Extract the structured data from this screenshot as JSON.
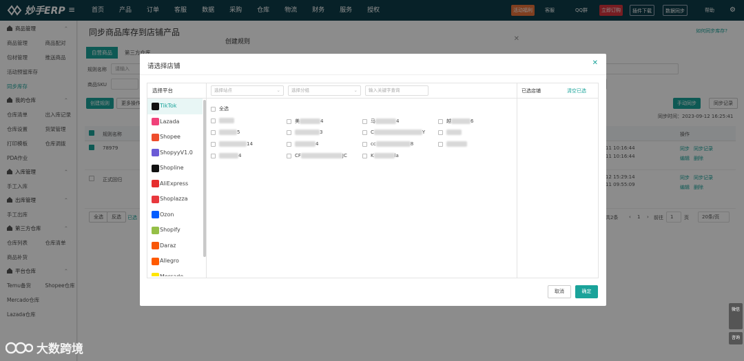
{
  "app": {
    "logo_text": "妙手ERP"
  },
  "nav": {
    "items": [
      "首页",
      "产品",
      "订单",
      "客服",
      "数据",
      "采购",
      "仓库",
      "物流",
      "财务",
      "服务",
      "授权"
    ]
  },
  "topbar": {
    "tools": [
      "活动福利",
      "客服",
      "QQ群",
      "立即订购",
      "插件下载",
      "数据同步",
      "帮助"
    ]
  },
  "sidebar": {
    "groups": [
      {
        "title": "商品管理",
        "rows": [
          [
            "商品管理",
            "商品配对"
          ],
          [
            "包材管理",
            "推送商品"
          ],
          [
            "活动预留库存",
            ""
          ],
          [
            "同步库存",
            ""
          ]
        ]
      },
      {
        "title": "我的仓库",
        "rows": [
          [
            "仓库清单",
            "出入库记录"
          ],
          [
            "仓库设置",
            "货架管理"
          ],
          [
            "打印模板",
            "仓库调拨"
          ],
          [
            "PDA作业",
            ""
          ]
        ]
      },
      {
        "title": "入库管理",
        "rows": [
          [
            "手工入库",
            ""
          ]
        ]
      },
      {
        "title": "出库管理",
        "rows": [
          [
            "手工出库",
            ""
          ]
        ]
      },
      {
        "title": "第三方仓库",
        "rows": [
          [
            "仓库列表",
            "仓库清单"
          ],
          [
            "商品补货",
            ""
          ]
        ]
      },
      {
        "title": "平台仓库",
        "rows": [
          [
            "Temu备货",
            "Shopee仓库"
          ],
          [
            "Mercado仓库",
            ""
          ],
          [
            "Lazada仓库",
            ""
          ]
        ]
      }
    ]
  },
  "main": {
    "title": "同步商品库存到店铺产品",
    "help_link": "如何同步库存?",
    "tabs": [
      "自营商品",
      "第三方仓库"
    ],
    "filters": {
      "rule_name_label": "规则名称",
      "rule_name_placeholder": "请输入",
      "sku_label": "商品SKU"
    },
    "buttons": {
      "create_rule": "创建规则",
      "more": "更多操作",
      "sync_now": "手动同步",
      "sync_log": "同步记录",
      "search": "搜索"
    },
    "sync_time": "同步时间：2023-09-12 16:25:41",
    "table": {
      "headers": [
        "规则名称",
        "操作"
      ],
      "rows": [
        {
          "name": "78979",
          "time": "11 10:16:44",
          "time2": "11 10:16:44",
          "actions": [
            "同步",
            "同步记录",
            "编辑",
            "删除"
          ]
        },
        {
          "name": "正式回归",
          "time": "12 15:29:14",
          "time2": "11 09:55:09",
          "actions": [
            "同步",
            "同步记录",
            "编辑",
            "删除"
          ]
        }
      ]
    },
    "footer": {
      "all": "全选",
      "invert": "反选",
      "selected": "已选",
      "pagination": {
        "total": "共2条",
        "page": "1",
        "goto_label": "前往",
        "goto_value": "1",
        "page_unit": "页",
        "page_size": "20条/页"
      }
    }
  },
  "rule_dialog": {
    "title": "创建规则"
  },
  "store_dialog": {
    "title": "请选择店铺",
    "platform_header": "选择平台",
    "platforms": [
      {
        "name": "TikTok",
        "color": "#111111",
        "selected": true
      },
      {
        "name": "Lazada",
        "color": "#f0427a",
        "selected": false
      },
      {
        "name": "Shopee",
        "color": "#ee4d2d",
        "selected": false
      },
      {
        "name": "ShopyyV1.0",
        "color": "#6b5bd6",
        "selected": false
      },
      {
        "name": "Shopline",
        "color": "#111111",
        "selected": false
      },
      {
        "name": "AliExpress",
        "color": "#e62e2e",
        "selected": false
      },
      {
        "name": "Shoplazza",
        "color": "#e8383d",
        "selected": false
      },
      {
        "name": "Ozon",
        "color": "#005bff",
        "selected": false
      },
      {
        "name": "Shopify",
        "color": "#95bf47",
        "selected": false
      },
      {
        "name": "Daraz",
        "color": "#f85606",
        "selected": false
      },
      {
        "name": "Allegro",
        "color": "#ff5a00",
        "selected": false
      },
      {
        "name": "Mercado",
        "color": "#ffe600",
        "selected": false
      }
    ],
    "filters": {
      "site_placeholder": "选择站点",
      "group_placeholder": "选择分组",
      "keyword_placeholder": "输入关键字查询"
    },
    "select_all": "全选",
    "stores": [
      {
        "prefix": "",
        "suffix": ""
      },
      {
        "prefix": "美",
        "suffix": "4"
      },
      {
        "prefix": "马",
        "suffix": "4"
      },
      {
        "prefix": "越",
        "suffix": "6"
      },
      {
        "prefix": "",
        "suffix": "5"
      },
      {
        "prefix": "",
        "suffix": "3"
      },
      {
        "prefix": "C",
        "suffix": "Y"
      },
      {
        "prefix": "",
        "suffix": ""
      },
      {
        "prefix": "",
        "suffix": "14"
      },
      {
        "prefix": "",
        "suffix": "4"
      },
      {
        "prefix": "cc",
        "suffix": "8"
      },
      {
        "prefix": "",
        "suffix": ""
      },
      {
        "prefix": "",
        "suffix": "4"
      },
      {
        "prefix": "CF",
        "suffix": "JC"
      },
      {
        "prefix": "K",
        "suffix": "la"
      }
    ],
    "selected_header": "已选店铺",
    "clear_selected": "清空已选",
    "cancel": "取消",
    "confirm": "确定"
  },
  "watermark": {
    "text": "大数跨境"
  },
  "side_tools": [
    "微信",
    "咨询"
  ]
}
